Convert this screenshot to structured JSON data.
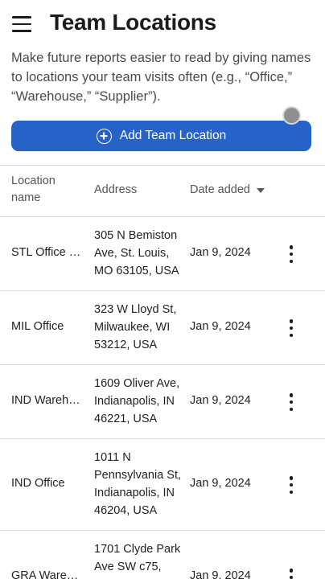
{
  "header": {
    "title": "Team Locations",
    "menu_icon": "hamburger-menu-icon"
  },
  "description": "Make future reports easier to read by giving names to locations your team visits often (e.g., “Office,” “Warehouse,” “Supplier”).",
  "add_button": {
    "label": "Add Team Location",
    "icon": "plus-circle-icon",
    "color": "#2563c9"
  },
  "table": {
    "columns": {
      "name": "Location name",
      "address": "Address",
      "date": "Date added"
    },
    "sort_icon": "caret-down-icon",
    "rows": [
      {
        "name": "STL Office (…",
        "address": [
          "305 N Bemiston",
          "Ave, St. Louis,",
          "MO 63105, USA"
        ],
        "date": "Jan 9, 2024"
      },
      {
        "name": "MIL Office",
        "address": [
          "323 W Lloyd St,",
          "Milwaukee, WI",
          "53212, USA"
        ],
        "date": "Jan 9, 2024"
      },
      {
        "name": "IND Wareho…",
        "address": [
          "1609 Oliver Ave,",
          "Indianapolis, IN",
          "46221, USA"
        ],
        "date": "Jan 9, 2024"
      },
      {
        "name": "IND Office",
        "address": [
          "1011 N",
          "Pennsylvania St,",
          "Indianapolis, IN",
          "46204, USA"
        ],
        "date": "Jan 9, 2024"
      },
      {
        "name": "GRA Wareh…",
        "address": [
          "1701 Clyde Park",
          "Ave SW c75,"
        ],
        "date": "Jan 9, 2024"
      }
    ],
    "row_action_icon": "more-vertical-icon"
  }
}
